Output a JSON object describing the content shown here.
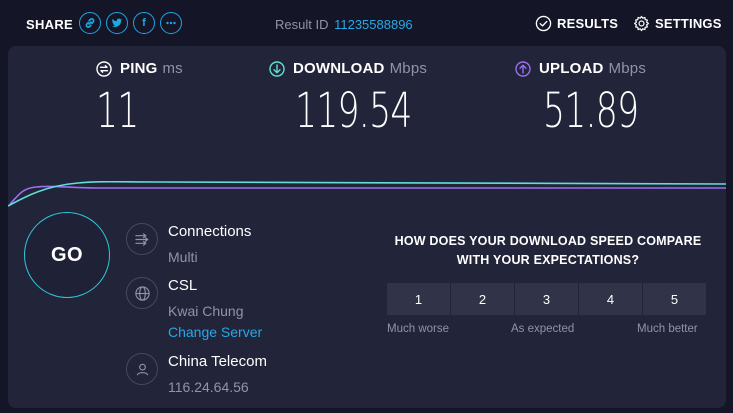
{
  "topbar": {
    "share_label": "SHARE",
    "share_icons": [
      "link-icon",
      "twitter-icon",
      "facebook-icon",
      "more-icon"
    ],
    "facebook_glyph": "f",
    "result_label": "Result ID",
    "result_id": "11235588896",
    "results_label": "RESULTS",
    "settings_label": "SETTINGS"
  },
  "metrics": {
    "ping": {
      "label": "PING",
      "unit": "ms",
      "value": "11"
    },
    "download": {
      "label": "DOWNLOAD",
      "unit": "Mbps",
      "value": "119.54"
    },
    "upload": {
      "label": "UPLOAD",
      "unit": "Mbps",
      "value": "51.89"
    }
  },
  "go_label": "GO",
  "connections": {
    "title": "Connections",
    "value": "Multi"
  },
  "server": {
    "name": "CSL",
    "location": "Kwai Chung",
    "change_label": "Change Server"
  },
  "isp": {
    "name": "China Telecom",
    "ip": "116.24.64.56"
  },
  "survey": {
    "question": "HOW DOES YOUR DOWNLOAD SPEED COMPARE WITH YOUR EXPECTATIONS?",
    "options": [
      "1",
      "2",
      "3",
      "4",
      "5"
    ],
    "low_label": "Much worse",
    "mid_label": "As expected",
    "high_label": "Much better"
  },
  "colors": {
    "background": "#141526",
    "panel": "#22243a",
    "accent_blue": "#1ea7e1",
    "download_line": "#5ee0d6",
    "upload_line": "#9b6ff0",
    "muted_text": "#9193a8"
  }
}
